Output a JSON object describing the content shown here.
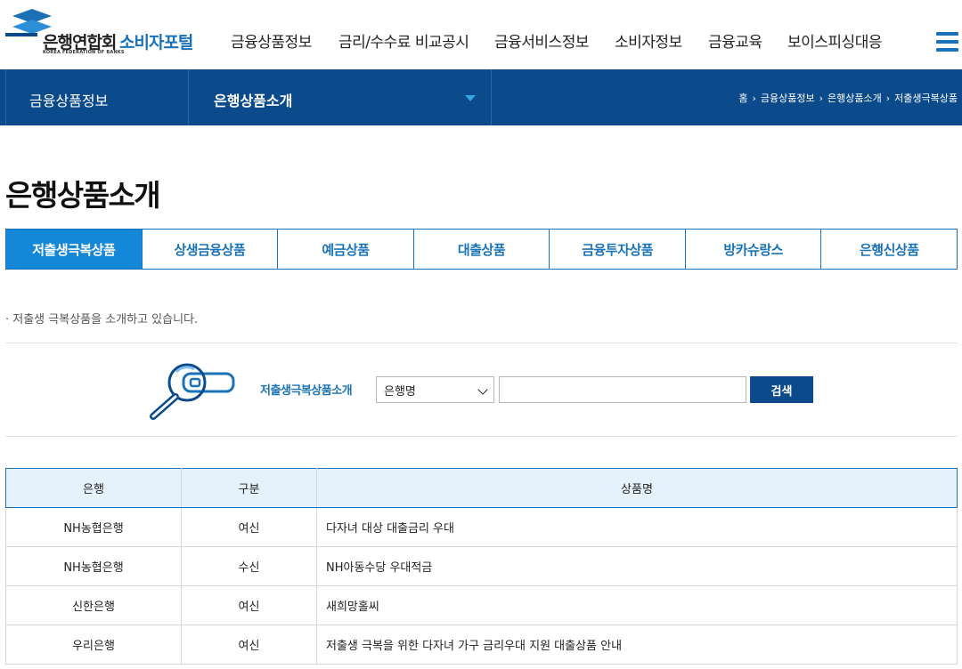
{
  "header": {
    "logo_name": "은행연합회",
    "logo_sub": "KOREA FEDERATION OF BANKS",
    "logo_portal": "소비자포털",
    "nav": [
      {
        "label": "금융상품정보"
      },
      {
        "label": "금리/수수료 비교공시"
      },
      {
        "label": "금융서비스정보"
      },
      {
        "label": "소비자정보"
      },
      {
        "label": "금융교육"
      },
      {
        "label": "보이스피싱대응"
      }
    ],
    "menu_icon": "hamburger-menu-icon",
    "accent_color": "#1a73b8"
  },
  "subnav": {
    "category": "금융상품정보",
    "current": "은행상품소개",
    "bg_color": "#0b4a8b",
    "breadcrumb": [
      "홈",
      "금융상품정보",
      "은행상품소개",
      "저출생극복상품"
    ]
  },
  "page": {
    "title": "은행상품소개",
    "tabs": [
      {
        "label": "저출생극복상품",
        "active": true
      },
      {
        "label": "상생금융상품",
        "active": false
      },
      {
        "label": "예금상품",
        "active": false
      },
      {
        "label": "대출상품",
        "active": false
      },
      {
        "label": "금융투자상품",
        "active": false
      },
      {
        "label": "방카슈랑스",
        "active": false
      },
      {
        "label": "은행신상품",
        "active": false
      }
    ],
    "description": "· 저출생 극복상품을 소개하고 있습니다."
  },
  "search": {
    "label": "저출생극복상품소개",
    "select_value": "은행명",
    "input_value": "",
    "button_label": "검색",
    "illustration_icon": "magnifier-card-icon"
  },
  "table": {
    "headers": [
      "은행",
      "구분",
      "상품명"
    ],
    "rows": [
      {
        "bank": "NH농협은행",
        "type": "여신",
        "product": "다자녀 대상 대출금리 우대"
      },
      {
        "bank": "NH농협은행",
        "type": "수신",
        "product": "NH아동수당 우대적금"
      },
      {
        "bank": "신한은행",
        "type": "여신",
        "product": "새희망홀씨"
      },
      {
        "bank": "우리은행",
        "type": "여신",
        "product": "저출생 극복을 위한 다자녀 가구 금리우대 지원 대출상품 안내"
      }
    ]
  }
}
